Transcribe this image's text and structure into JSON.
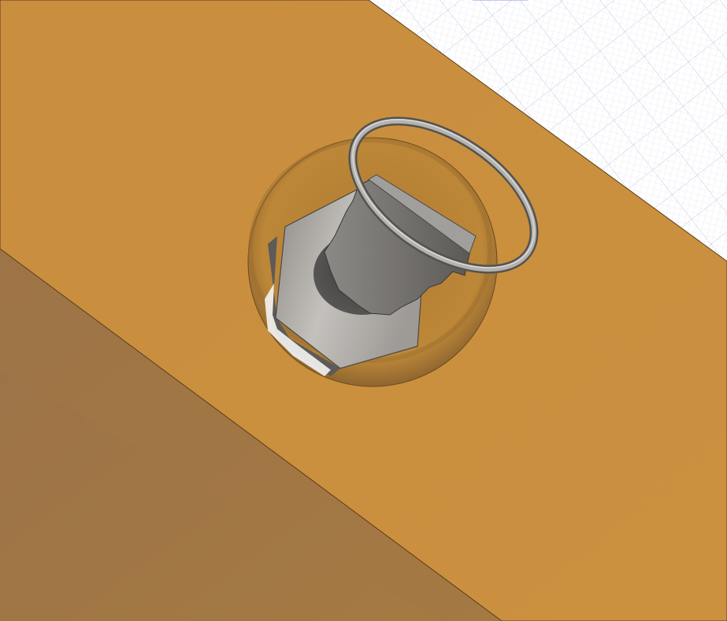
{
  "viewport": {
    "label": ""
  },
  "scene": {
    "grid_color": "#d9dde8",
    "grid_major_color": "#c3c9d8",
    "axis_color": "#8a8ff0",
    "board_top_color": "#c98e3e",
    "board_side_color": "#a07748",
    "hole_color": "#b98336",
    "metal_light": "#b3b0ac",
    "metal_dark": "#4a4846",
    "ring_color": "#9a9896",
    "objects": [
      "wooden-board",
      "drilled-hole",
      "hex-nut",
      "stepped-shaft",
      "pull-ring"
    ]
  }
}
